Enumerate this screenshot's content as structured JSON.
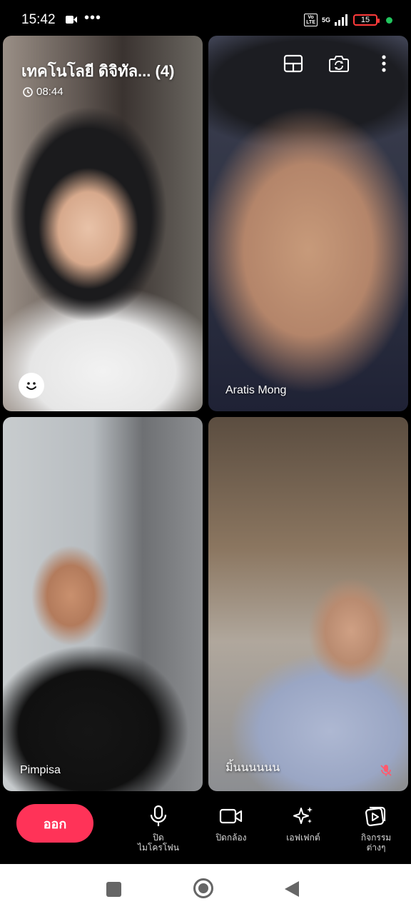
{
  "status": {
    "time": "15:42",
    "more": "•••",
    "volte_line1": "Vo",
    "volte_line2": "LTE",
    "network": "5G",
    "battery": "15"
  },
  "meeting": {
    "title": "เทคโนโลยี ดิจิทัล... (4)",
    "timer": "08:44"
  },
  "participants": [
    {
      "name": ""
    },
    {
      "name": "Aratis Mong"
    },
    {
      "name": "Pimpisa"
    },
    {
      "name": "มิ้นนนนนน",
      "muted": true
    }
  ],
  "controls": {
    "leave": "ออก",
    "mic_line1": "ปิด",
    "mic_line2": "ไมโครโฟน",
    "camera": "ปิดกล้อง",
    "effects": "เอฟเฟกต์",
    "activities_line1": "กิจกรรม",
    "activities_line2": "ต่างๆ"
  },
  "colors": {
    "leave_button": "#ff3358",
    "battery_low": "#ff3b3b",
    "indicator_dot": "#22c55e"
  }
}
